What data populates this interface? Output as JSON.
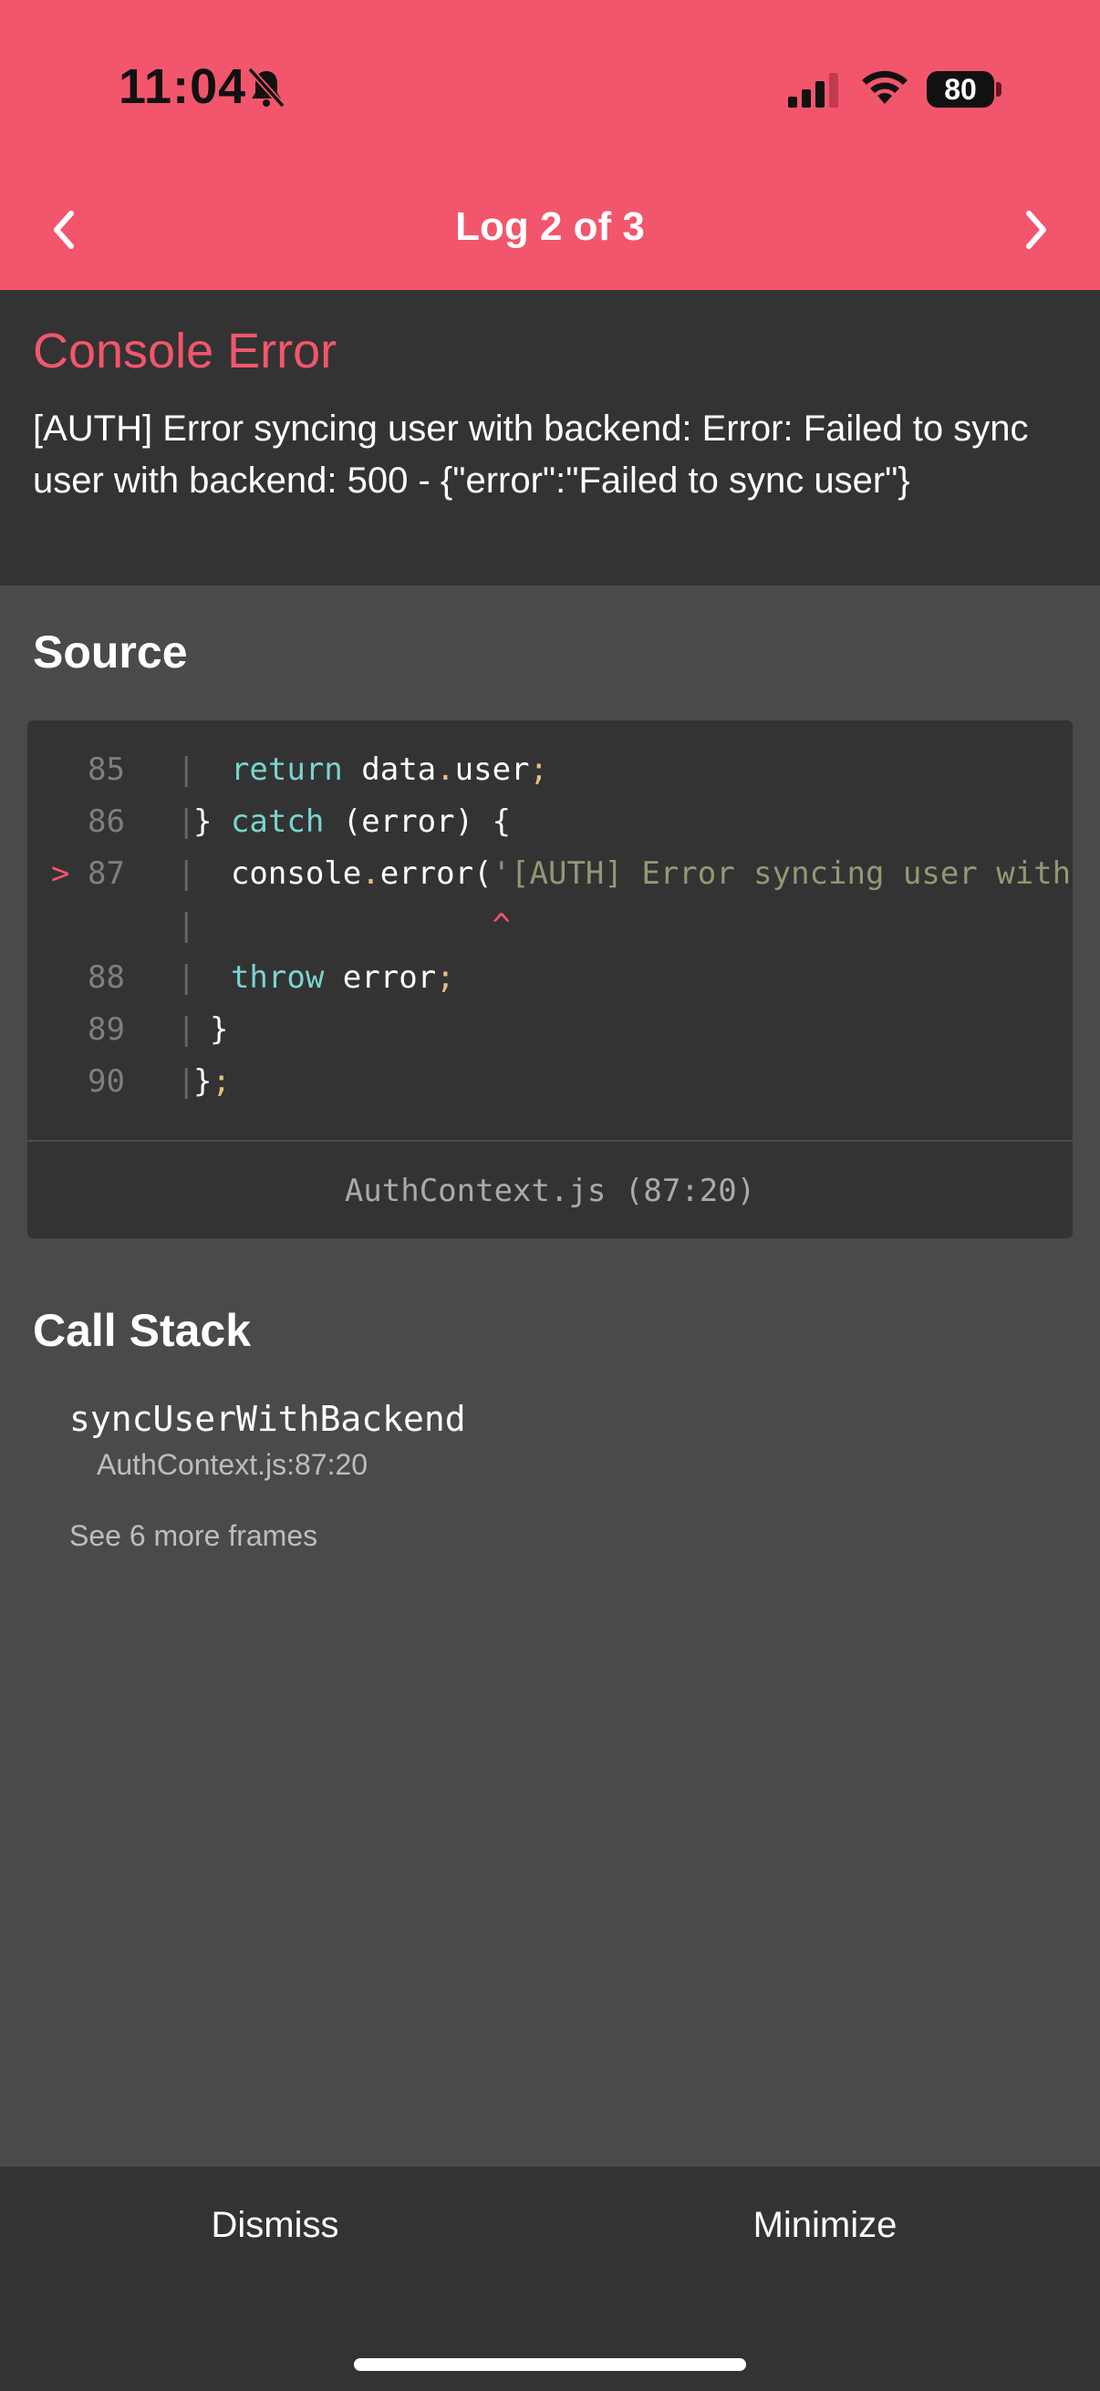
{
  "status_bar": {
    "time": "11:04",
    "battery": "80",
    "icons": [
      "bell-slash-icon",
      "signal-icon",
      "wifi-icon",
      "battery-icon"
    ]
  },
  "nav": {
    "title": "Log 2 of 3",
    "prev_icon": "chevron-left-icon",
    "next_icon": "chevron-right-icon"
  },
  "error": {
    "title": "Console Error",
    "message": "[AUTH] Error syncing user with backend: Error: Failed to sync user with backend: 500 - {\"error\":\"Failed to sync user\"}"
  },
  "source": {
    "title": "Source",
    "lines": [
      {
        "marker": "",
        "num": "85",
        "bar": "|"
      },
      {
        "marker": "",
        "num": "86",
        "bar": "|"
      },
      {
        "marker": ">",
        "num": "87",
        "bar": "|"
      },
      {
        "marker": "",
        "num": "",
        "bar": "|"
      },
      {
        "marker": "",
        "num": "88",
        "bar": "|"
      },
      {
        "marker": "",
        "num": "89",
        "bar": "|"
      },
      {
        "marker": "",
        "num": "90",
        "bar": "|"
      }
    ],
    "code": {
      "l85": {
        "indent": "  ",
        "kw": "return",
        "text": " data",
        "dot": ".",
        "rest": "user",
        "end": ";"
      },
      "l86": {
        "indent": "",
        "brace": "} ",
        "kw": "catch",
        "rest": " (error) {"
      },
      "l87": {
        "indent": "  ",
        "obj": "console",
        "dot": ".",
        "fn": "error(",
        "str": "'[AUTH] Error syncing user with backend:'"
      },
      "l87b": {
        "caret": "                ^"
      },
      "l88": {
        "indent": "  ",
        "kw": "throw",
        "text": " error",
        "end": ";"
      },
      "l89": {
        "text": "}"
      },
      "l90": {
        "text": "}",
        "end": ";"
      }
    },
    "location": "AuthContext.js (87:20)"
  },
  "call_stack": {
    "title": "Call Stack",
    "frames": [
      {
        "name": "syncUserWithBackend",
        "location": "AuthContext.js:87:20"
      }
    ],
    "more": "See 6 more frames"
  },
  "actions": {
    "dismiss": "Dismiss",
    "minimize": "Minimize"
  },
  "colors": {
    "accent": "#f2566c",
    "panel": "#333333",
    "background": "#4a4a4a",
    "keyword": "#79d4cf",
    "string": "#8f9a74",
    "punctuation": "#e6c07b"
  }
}
